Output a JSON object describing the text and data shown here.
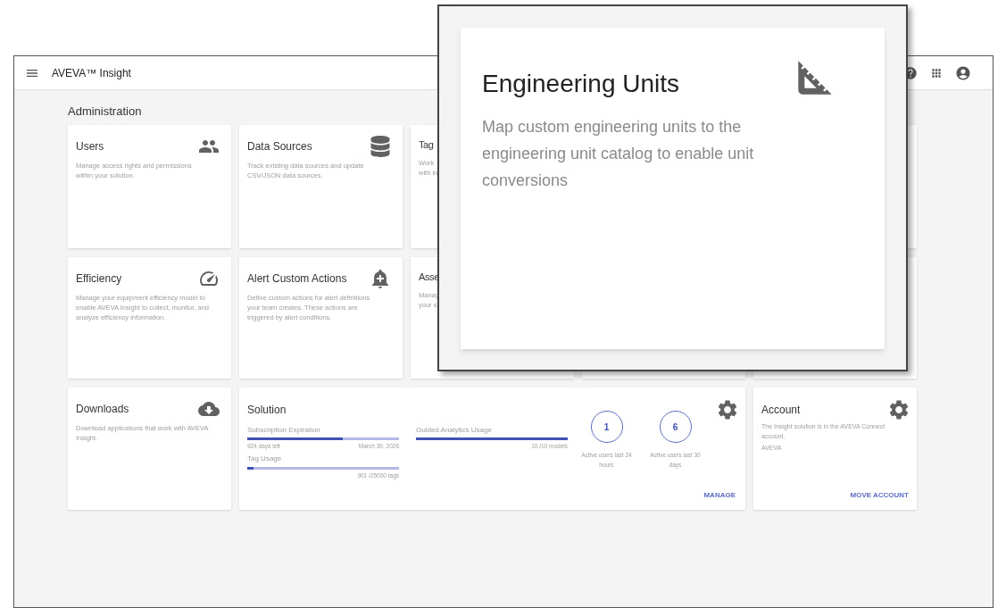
{
  "header": {
    "title": "AVEVA™ Insight"
  },
  "page_title": "Administration",
  "tiles": [
    {
      "kind": "tile",
      "title": "Users",
      "description": "Manage access rights and permissions within your solution."
    },
    {
      "kind": "tile",
      "title": "Data Sources",
      "description": "Track existing data sources and update CSV/JSON data sources."
    },
    {
      "kind": "partial",
      "title": "Tag",
      "lines": [
        "Work",
        "with in"
      ]
    },
    {
      "kind": "tile",
      "title": "Efficiency",
      "description": "Manage your equipment efficiency model to enable AVEVA Insight to collect, monitor, and analyze efficiency information."
    },
    {
      "kind": "tile",
      "title": "Alert Custom Actions",
      "description": "Define custom actions for alert definitions your team creates. These actions are triggered by alert conditions."
    },
    {
      "kind": "partial",
      "title": "Asse",
      "lines": [
        "Manag",
        "your s"
      ]
    },
    {
      "kind": "tile",
      "title": "Downloads",
      "description": "Download applications that work with AVEVA Insight."
    }
  ],
  "solution": {
    "title": "Solution",
    "subscription": {
      "label": "Subscription Expiration",
      "level": 0.63,
      "left": "924 days left",
      "right": "March 30, 2026"
    },
    "tag_usage": {
      "label": "Tag Usage",
      "level": 0.04,
      "right": "901 /25000 tags"
    },
    "guided_analytics": {
      "label": "Guided Analytics Usage",
      "level": 1,
      "right": "10 /10 models"
    },
    "stats": [
      {
        "value": "1",
        "label": "Active users last 24 hours"
      },
      {
        "value": "6",
        "label": "Active users last 30 days"
      }
    ],
    "action": "MANAGE"
  },
  "account": {
    "title": "Account",
    "description": "The Insight solution is in the AVEVA Connect account.",
    "name": "AVEVA",
    "action": "MOVE ACCOUNT"
  },
  "callout": {
    "title": "Engineering Units",
    "description": "Map custom engineering units to the engineering unit catalog to enable unit conversions"
  }
}
